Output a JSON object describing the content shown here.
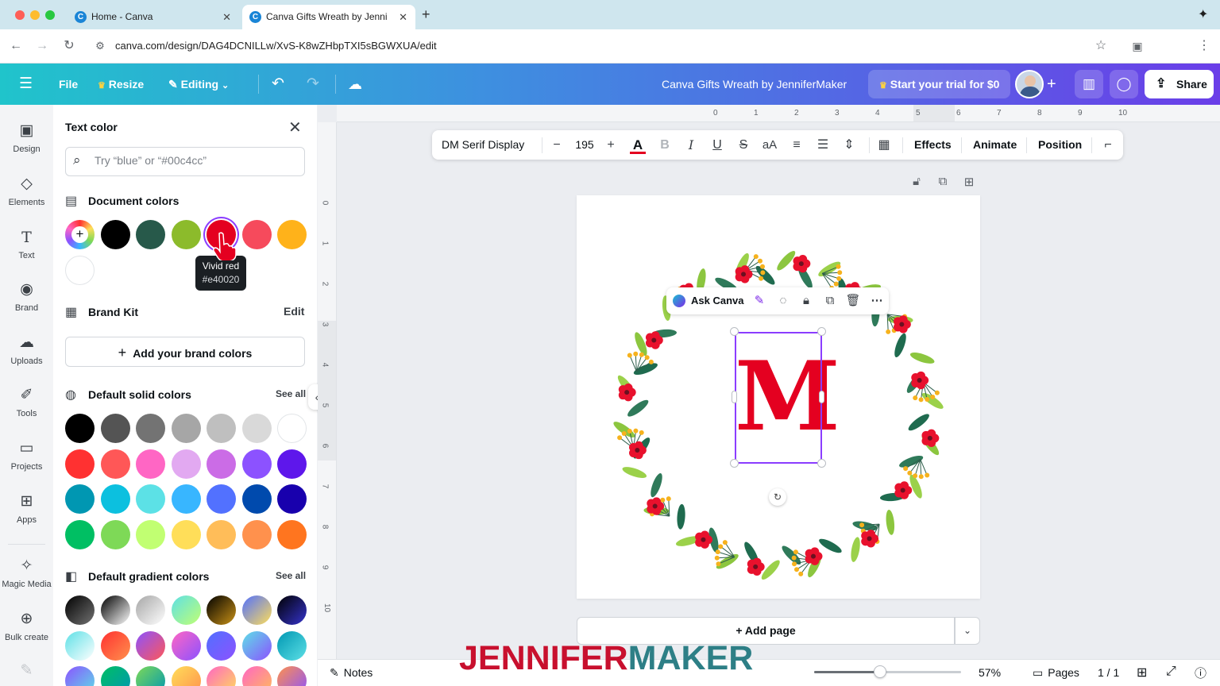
{
  "browser": {
    "tabs": [
      {
        "title": "Home - Canva",
        "active": false
      },
      {
        "title": "Canva Gifts Wreath by Jenni",
        "active": true
      }
    ],
    "url": "canva.com/design/DAG4DCNILLw/XvS-K8wZHbpTXI5sBGWXUA/edit"
  },
  "header": {
    "file": "File",
    "resize": "Resize",
    "editing": "Editing",
    "design_title": "Canva Gifts Wreath by JenniferMaker",
    "trial": "Start your trial for $0",
    "share": "Share"
  },
  "rail": [
    {
      "label": "Design",
      "icon": "design-icon"
    },
    {
      "label": "Elements",
      "icon": "elements-icon"
    },
    {
      "label": "Text",
      "icon": "text-icon"
    },
    {
      "label": "Brand",
      "icon": "brand-icon"
    },
    {
      "label": "Uploads",
      "icon": "uploads-icon"
    },
    {
      "label": "Tools",
      "icon": "tools-icon"
    },
    {
      "label": "Projects",
      "icon": "projects-icon"
    },
    {
      "label": "Apps",
      "icon": "apps-icon"
    },
    {
      "label": "Magic Media",
      "icon": "magic-media-icon"
    },
    {
      "label": "Bulk create",
      "icon": "bulk-create-icon"
    }
  ],
  "panel": {
    "title": "Text color",
    "search_placeholder": "Try “blue” or “#00c4cc”",
    "document_colors_label": "Document colors",
    "document_colors": [
      "#000000",
      "#27594a",
      "#8cbb2b",
      "#e40020",
      "#f64a5c",
      "#ffb21a",
      "#ffffff"
    ],
    "tooltip": {
      "name": "Vivid red",
      "hex": "#e40020"
    },
    "brand_kit_label": "Brand Kit",
    "brand_edit": "Edit",
    "add_brand": "Add your brand colors",
    "solid_label": "Default solid colors",
    "gradient_label": "Default gradient colors",
    "see_all": "See all",
    "solid_colors": [
      [
        "#000000",
        "#545454",
        "#737373",
        "#a6a6a6",
        "#bfbfbf",
        "#d9d9d9",
        "#ffffff"
      ],
      [
        "#ff3131",
        "#ff5757",
        "#ff66c4",
        "#e2a9f1",
        "#cb6ce6",
        "#8c52ff",
        "#5e17eb"
      ],
      [
        "#0097b2",
        "#0cc0df",
        "#5ce1e6",
        "#38b6ff",
        "#5271ff",
        "#004aad",
        "#1800ad"
      ],
      [
        "#00bf63",
        "#7ed957",
        "#c1ff72",
        "#ffde59",
        "#ffbd59",
        "#ff914d",
        "#ff751f"
      ]
    ],
    "gradient_colors": [
      [
        "#000000|#737373",
        "#000000|#ffffff",
        "#a6a6a6|#ffffff",
        "#5de0e6|#c1ff72",
        "#000000|#c89116",
        "#5170ff|#ffde59",
        "#000000|#3533cd"
      ],
      [
        "#5de0e6|#ffffff",
        "#ff3131|#ff914d",
        "#8c52ff|#ff5757",
        "#ff66c4|#8c52ff",
        "#5170ff|#8c52ff",
        "#5de0e6|#8c52ff",
        "#0097b2|#5de0e6"
      ],
      [
        "#8c52ff|#5ce1e6",
        "#00bf63|#0097b2",
        "#7ed957|#0097b2",
        "#ffde59|#ff914d",
        "#ff66c4|#ffde59",
        "#ff66c4|#ffbd59",
        "#ff914d|#8c52ff"
      ]
    ]
  },
  "textbar": {
    "font": "DM Serif Display",
    "size": "195",
    "effects": "Effects",
    "animate": "Animate",
    "position": "Position"
  },
  "canvas": {
    "context_label": "Ask Canva",
    "letter": "M",
    "letter_color": "#e40020",
    "add_page": "+ Add page",
    "ruler_top": [
      "0",
      "1",
      "2",
      "3",
      "4",
      "5",
      "6",
      "7",
      "8",
      "9",
      "10"
    ],
    "ruler_left": [
      "0",
      "1",
      "2",
      "3",
      "4",
      "5",
      "6",
      "7",
      "8",
      "9",
      "10"
    ]
  },
  "footer": {
    "notes": "Notes",
    "zoom": "57%",
    "zoom_fraction": 0.45,
    "pages": "Pages",
    "page_count": "1 / 1"
  },
  "watermark": {
    "part1": "JENNIFER",
    "part2": "MAKER"
  }
}
